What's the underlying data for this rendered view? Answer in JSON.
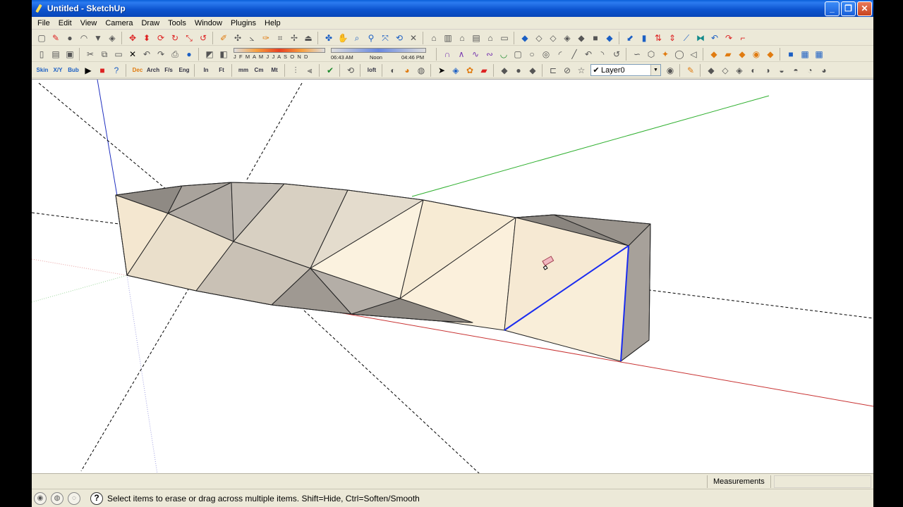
{
  "window": {
    "title": "Untitled - SketchUp",
    "minimize": "_",
    "maximize": "❐",
    "close": "✕"
  },
  "menu": [
    "File",
    "Edit",
    "View",
    "Camera",
    "Draw",
    "Tools",
    "Window",
    "Plugins",
    "Help"
  ],
  "shadow": {
    "months": "J F M A M J J A S O N D",
    "time_start": "06:43 AM",
    "time_mid": "Noon",
    "time_end": "04:46 PM"
  },
  "units_toolbar": {
    "skin": "Skin",
    "xyz": "X/Y",
    "bub": "Bub",
    "dec": "Dec",
    "arch": "Arch",
    "frac": "F/s",
    "eng": "Eng",
    "in": "In",
    "ft": "Ft",
    "mm": "mm",
    "cm": "Cm",
    "mt": "Mt",
    "loft": "loft"
  },
  "layer": {
    "check": "✔",
    "name": "Layer0"
  },
  "measurements": {
    "label": "Measurements",
    "value": ""
  },
  "status": {
    "help": "?",
    "message": "Select items to erase or drag across multiple items. Shift=Hide, Ctrl=Soften/Smooth"
  },
  "colors": {
    "title_blue": "#0d55d0",
    "axis_red": "#c83232",
    "axis_green": "#30b030",
    "axis_blue": "#2030c0",
    "face_light": "#f7ecd6",
    "face_shade": "#a8a29a",
    "selected_edge": "#1a2cf0"
  }
}
